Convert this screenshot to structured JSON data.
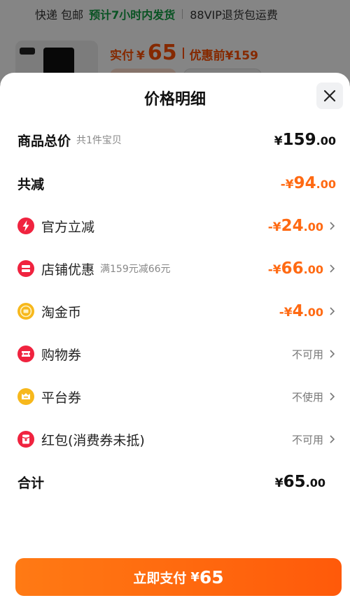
{
  "background": {
    "shipping": "快递 包邮",
    "ship_time": "预计7小时内发货",
    "vip": "88VIP退货包运费",
    "paid_label": "实付",
    "paid_symbol": "¥",
    "paid_value": "65",
    "before_label": "优惠前",
    "before_value": "¥159"
  },
  "sheet": {
    "title": "价格明细",
    "rows": [
      {
        "label": "商品总价",
        "sub": "共1件宝贝",
        "symbol": "¥",
        "int": "159",
        "dec": ".00"
      },
      {
        "label": "共减",
        "symbol": "-¥",
        "int": "94",
        "dec": ".00"
      },
      {
        "label": "官方立减",
        "icon": "lightning-icon",
        "symbol": "-¥",
        "int": "24",
        "dec": ".00"
      },
      {
        "label": "店铺优惠",
        "icon": "shop-coupon-icon",
        "sub": "满159元减66元",
        "symbol": "-¥",
        "int": "66",
        "dec": ".00"
      },
      {
        "label": "淘金币",
        "icon": "gold-coin-icon",
        "symbol": "-¥",
        "int": "4",
        "dec": ".00"
      },
      {
        "label": "购物券",
        "icon": "shopping-voucher-icon",
        "status": "不可用"
      },
      {
        "label": "平台券",
        "icon": "platform-coupon-icon",
        "status": "不使用"
      },
      {
        "label": "红包(消费券未抵)",
        "icon": "red-packet-icon",
        "status": "不可用"
      },
      {
        "label": "合计",
        "symbol": "¥",
        "int": "65",
        "dec": ".00"
      }
    ],
    "pay_button": {
      "label": "立即支付",
      "symbol": "¥",
      "value": "65"
    }
  },
  "colors": {
    "accent": "#ff6a13",
    "green": "#12a044",
    "red_icon": "#f0233f",
    "yellow_icon": "#f7b81c"
  }
}
